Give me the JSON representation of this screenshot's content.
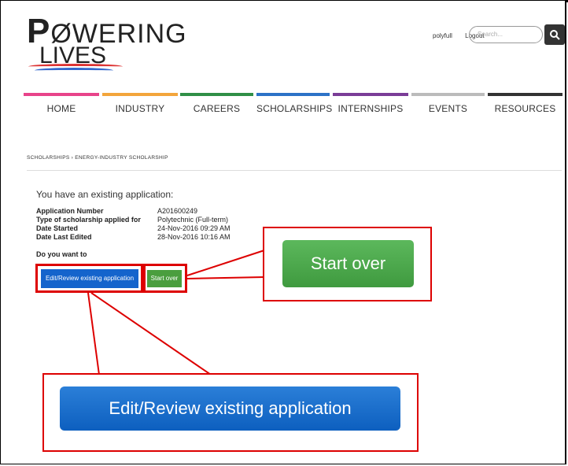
{
  "logo": {
    "line1_first": "P",
    "line1_rest": "ØWERING",
    "line2": "LIVES"
  },
  "header": {
    "user": "polyfull",
    "logout": "Logout",
    "search_placeholder": "Search..."
  },
  "nav": {
    "items": [
      {
        "label": "HOME",
        "color": "#e8438a"
      },
      {
        "label": "INDUSTRY",
        "color": "#f3a53b"
      },
      {
        "label": "CAREERS",
        "color": "#2f8f46"
      },
      {
        "label": "SCHOLARSHIPS",
        "color": "#2c72c7"
      },
      {
        "label": "INTERNSHIPS",
        "color": "#7a3c97"
      },
      {
        "label": "EVENTS",
        "color": "#bbbbbb"
      },
      {
        "label": "RESOURCES",
        "color": "#333333"
      }
    ]
  },
  "breadcrumb": "SCHOLARSHIPS  ›  ENERGY-INDUSTRY SCHOLARSHIP",
  "main": {
    "heading": "You have an existing application:",
    "details": [
      {
        "label": "Application Number",
        "value": "A201600249"
      },
      {
        "label": "Type of scholarship applied for",
        "value": "Polytechnic (Full-term)"
      },
      {
        "label": "Date Started",
        "value": "24-Nov-2016 09:29 AM"
      },
      {
        "label": "Date Last Edited",
        "value": "28-Nov-2016 10:16 AM"
      }
    ],
    "question": "Do you want to",
    "edit_button": "Edit/Review existing application",
    "start_button": "Start over"
  },
  "callouts": {
    "start_over": "Start over",
    "edit_review": "Edit/Review existing application"
  }
}
